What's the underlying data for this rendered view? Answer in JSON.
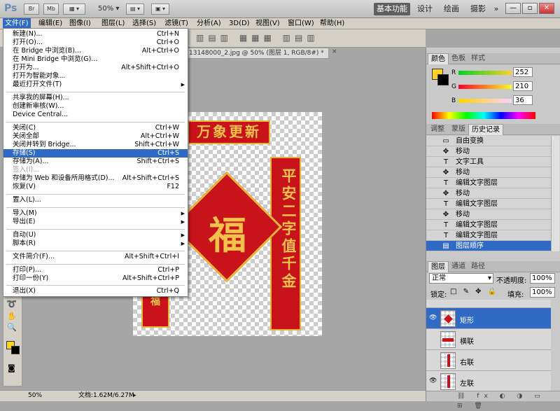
{
  "app": {
    "logo": "Ps",
    "zoom": "50%",
    "bridge_label": "Br",
    "minibridge_label": "Mb"
  },
  "workspaces": [
    "基本功能",
    "设计",
    "绘画",
    "摄影"
  ],
  "workspace_more": "»",
  "window_controls": {
    "minimize": "—",
    "restore": "▫",
    "close": "✕"
  },
  "menubar": [
    "文件(F)",
    "编辑(E)",
    "图像(I)",
    "图层(L)",
    "选择(S)",
    "滤镜(T)",
    "分析(A)",
    "3D(D)",
    "视图(V)",
    "窗口(W)",
    "帮助(H)"
  ],
  "document_tab": "13148000_2.jpg @ 50% (图层 1, RGB/8#) *",
  "file_menu": [
    {
      "label": "新建(N)...",
      "shortcut": "Ctrl+N"
    },
    {
      "label": "打开(O)...",
      "shortcut": "Ctrl+O"
    },
    {
      "label": "在 Bridge 中浏览(B)...",
      "shortcut": "Alt+Ctrl+O"
    },
    {
      "label": "在 Mini Bridge 中浏览(G)...",
      "shortcut": ""
    },
    {
      "label": "打开为...",
      "shortcut": "Alt+Shift+Ctrl+O"
    },
    {
      "label": "打开为智能对象...",
      "shortcut": ""
    },
    {
      "label": "最近打开文件(T)",
      "shortcut": "",
      "submenu": true
    },
    {
      "label": "共享我的屏幕(H)...",
      "shortcut": ""
    },
    {
      "label": "创建新审核(W)...",
      "shortcut": ""
    },
    {
      "label": "Device Central...",
      "shortcut": ""
    },
    {
      "label": "关闭(C)",
      "shortcut": "Ctrl+W"
    },
    {
      "label": "关闭全部",
      "shortcut": "Alt+Ctrl+W"
    },
    {
      "label": "关闭并转到 Bridge...",
      "shortcut": "Shift+Ctrl+W"
    },
    {
      "label": "存储(S)",
      "shortcut": "Ctrl+S"
    },
    {
      "label": "存储为(A)...",
      "shortcut": "Shift+Ctrl+S"
    },
    {
      "label": "签入(I)...",
      "shortcut": ""
    },
    {
      "label": "存储为 Web 和设备所用格式(D)...",
      "shortcut": "Alt+Shift+Ctrl+S"
    },
    {
      "label": "恢复(V)",
      "shortcut": "F12"
    },
    {
      "label": "置入(L)...",
      "shortcut": ""
    },
    {
      "label": "导入(M)",
      "shortcut": "",
      "submenu": true
    },
    {
      "label": "导出(E)",
      "shortcut": "",
      "submenu": true
    },
    {
      "label": "自动(U)",
      "shortcut": "",
      "submenu": true
    },
    {
      "label": "脚本(R)",
      "shortcut": "",
      "submenu": true
    },
    {
      "label": "文件简介(F)...",
      "shortcut": "Alt+Shift+Ctrl+I"
    },
    {
      "label": "打印(P)...",
      "shortcut": "Ctrl+P"
    },
    {
      "label": "打印一份(Y)",
      "shortcut": "Alt+Shift+Ctrl+P"
    },
    {
      "label": "退出(X)",
      "shortcut": "Ctrl+Q"
    }
  ],
  "canvas_art": {
    "top_banner": "万象更新",
    "right_banner": "平安二字值千金",
    "diamond": "福",
    "small_banner": "福"
  },
  "status": {
    "zoom": "50%",
    "doc": "文档:1.62M/6.27M"
  },
  "color_panel": {
    "tabs": [
      "颜色",
      "色板",
      "样式"
    ],
    "r_label": "R",
    "g_label": "G",
    "b_label": "B",
    "r": "252",
    "g": "210",
    "b": "36",
    "fg_color": "#fcd224",
    "bg_color": "#000000"
  },
  "history_panel": {
    "tabs": [
      "调整",
      "蒙版",
      "历史记录"
    ],
    "items": [
      {
        "icon": "▭",
        "label": "自由变换"
      },
      {
        "icon": "✥",
        "label": "移动"
      },
      {
        "icon": "T",
        "label": "文字工具"
      },
      {
        "icon": "✥",
        "label": "移动"
      },
      {
        "icon": "T",
        "label": "编辑文字图层"
      },
      {
        "icon": "✥",
        "label": "移动"
      },
      {
        "icon": "T",
        "label": "编辑文字图层"
      },
      {
        "icon": "✥",
        "label": "移动"
      },
      {
        "icon": "T",
        "label": "编辑文字图层"
      },
      {
        "icon": "T",
        "label": "编辑文字图层"
      },
      {
        "icon": "▤",
        "label": "图层顺序"
      }
    ]
  },
  "layers_panel": {
    "tabs": [
      "图层",
      "通道",
      "路径"
    ],
    "blend_mode": "正常",
    "opacity_label": "不透明度:",
    "opacity": "100%",
    "lock_label": "锁定:",
    "fill_label": "填充:",
    "fill": "100%",
    "layers": [
      {
        "name": "矩形",
        "selected": true
      },
      {
        "name": "横联",
        "selected": false
      },
      {
        "name": "右联",
        "selected": false
      },
      {
        "name": "左联",
        "selected": false
      }
    ]
  }
}
